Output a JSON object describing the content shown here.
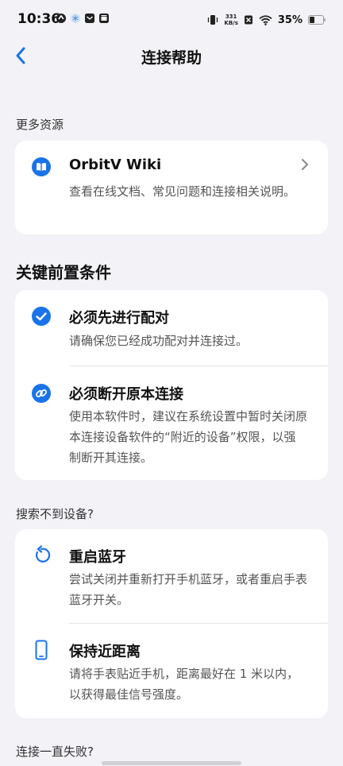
{
  "status_bar": {
    "time": "10:36",
    "speed_value": "331",
    "speed_unit": "KB/s",
    "battery": "35%"
  },
  "header": {
    "title": "连接帮助"
  },
  "resources": {
    "section_title": "更多资源",
    "wiki": {
      "title": "OrbitV Wiki",
      "description": "查看在线文档、常见问题和连接相关说明。",
      "icon": "book-icon"
    }
  },
  "prerequisites": {
    "section_title": "关键前置条件",
    "items": [
      {
        "title": "必须先进行配对",
        "description": "请确保您已经成功配对并连接过。",
        "icon": "check-circle-icon"
      },
      {
        "title": "必须断开原本连接",
        "description": "使用本软件时，建议在系统设置中暂时关闭原本连接设备软件的“附近的设备”权限，以强制断开其连接。",
        "icon": "link-circle-icon"
      }
    ]
  },
  "not_found": {
    "section_title": "搜索不到设备?",
    "items": [
      {
        "title": "重启蓝牙",
        "description": "尝试关闭并重新打开手机蓝牙，或者重启手表蓝牙开关。",
        "icon": "restart-icon"
      },
      {
        "title": "保持近距离",
        "description": "请将手表贴近手机，距离最好在 1 米以内，以获得最佳信号强度。",
        "icon": "phone-icon"
      }
    ]
  },
  "connection_failed": {
    "section_title": "连接一直失败?"
  },
  "colors": {
    "accent": "#1a73e8",
    "background": "#f2f2f7",
    "card": "#ffffff"
  }
}
